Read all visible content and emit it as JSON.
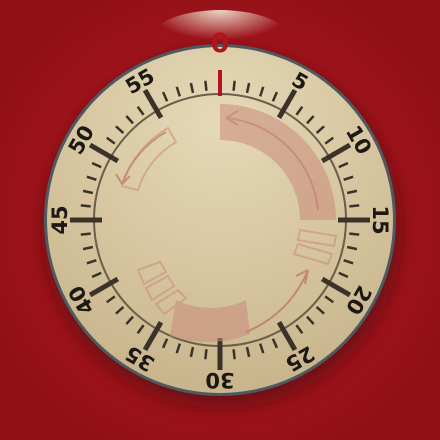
{
  "timer": {
    "selected_minute": "0",
    "minute_labels": [
      "5",
      "10",
      "15",
      "20",
      "25",
      "30",
      "35",
      "40",
      "45",
      "50",
      "55"
    ]
  },
  "colors": {
    "background": "#a8141c",
    "dial_face": "#d9c9a3",
    "dial_rim": "#4e5a60",
    "tick": "#3b322a",
    "pointer": "#b0141c",
    "arrow_graphic": "#c98b7c"
  },
  "icons": {
    "pointer": "pointer-icon",
    "arrows": "circular-arrows-icon"
  }
}
